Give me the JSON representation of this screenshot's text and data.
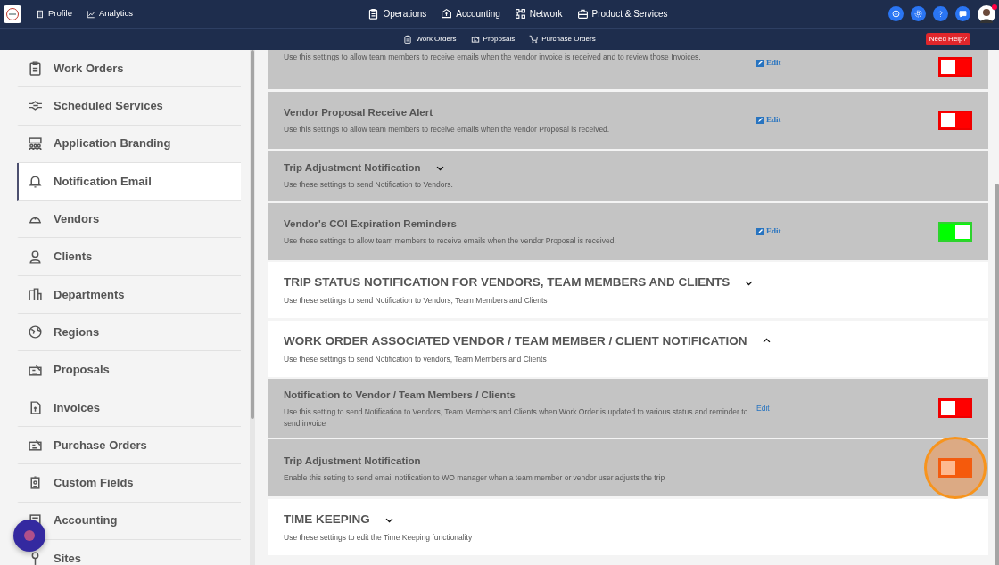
{
  "navbar": {
    "left_links": [
      {
        "label": "Profile"
      },
      {
        "label": "Analytics"
      }
    ],
    "menus": [
      {
        "label": "Operations"
      },
      {
        "label": "Accounting"
      },
      {
        "label": "Network"
      },
      {
        "label": "Product & Services"
      }
    ],
    "notification_dot": true
  },
  "subnav": {
    "links": [
      {
        "label": "Work Orders"
      },
      {
        "label": "Proposals"
      },
      {
        "label": "Purchase Orders"
      }
    ],
    "help": "Need Help?"
  },
  "sidebar": {
    "items": [
      {
        "label": "Work Orders",
        "selected": false
      },
      {
        "label": "Scheduled Services",
        "selected": false
      },
      {
        "label": "Application Branding",
        "selected": false
      },
      {
        "label": "Notification Email",
        "selected": true
      },
      {
        "label": "Vendors",
        "selected": false
      },
      {
        "label": "Clients",
        "selected": false
      },
      {
        "label": "Departments",
        "selected": false
      },
      {
        "label": "Regions",
        "selected": false
      },
      {
        "label": "Proposals",
        "selected": false
      },
      {
        "label": "Invoices",
        "selected": false
      },
      {
        "label": "Purchase Orders",
        "selected": false
      },
      {
        "label": "Custom Fields",
        "selected": false
      },
      {
        "label": "Accounting",
        "selected": false
      },
      {
        "label": "Sites",
        "selected": false
      }
    ]
  },
  "sections": [
    {
      "kind": "setting",
      "description": "Use this settings to allow team members to receive emails when the vendor invoice is received and to review those Invoices.",
      "edit": {
        "label": "Edit",
        "icon": true
      },
      "on": false,
      "highlighted": false
    },
    {
      "kind": "setting",
      "title": "Vendor Proposal Receive Alert",
      "description": "Use this settings to allow team members to receive emails when the vendor Proposal is received.",
      "edit": {
        "label": "Edit",
        "icon": true
      },
      "on": false,
      "highlighted": false
    },
    {
      "kind": "subgroup",
      "title": "Trip Adjustment Notification",
      "description": "Use these settings to send Notification to Vendors.",
      "expanded": false
    },
    {
      "kind": "setting",
      "title": "Vendor's COI Expiration Reminders",
      "description": "Use these settings to allow team members to receive emails when the vendor Proposal is received.",
      "edit": {
        "label": "Edit",
        "icon": true
      },
      "on": true,
      "highlighted": false
    },
    {
      "kind": "group",
      "title": "TRIP STATUS NOTIFICATION FOR VENDORS, TEAM MEMBERS AND CLIENTS",
      "description": "Use these settings to send Notification to Vendors, Team Members and Clients",
      "expanded": false
    },
    {
      "kind": "group",
      "title": "WORK ORDER ASSOCIATED VENDOR / TEAM MEMBER / CLIENT NOTIFICATION",
      "description": "Use these settings to send Notification to vendors, Team Members and Clients",
      "expanded": true
    },
    {
      "kind": "setting",
      "title": "Notification to Vendor / Team Members / Clients",
      "description": "Use this setting to send Notification to Vendors, Team Members and Clients when Work Order is updated to various status and reminder to send invoice",
      "edit": {
        "label": "Edit",
        "icon": false
      },
      "on": false,
      "highlighted": false
    },
    {
      "kind": "setting",
      "title": "Trip Adjustment Notification",
      "description": "Enable this setting to send email notification to WO manager when a team member or vendor user adjusts the trip",
      "on": false,
      "highlighted": true
    },
    {
      "kind": "group",
      "title": "TIME KEEPING",
      "description": "Use these settings to edit the Time Keeping functionality",
      "expanded": false
    }
  ]
}
